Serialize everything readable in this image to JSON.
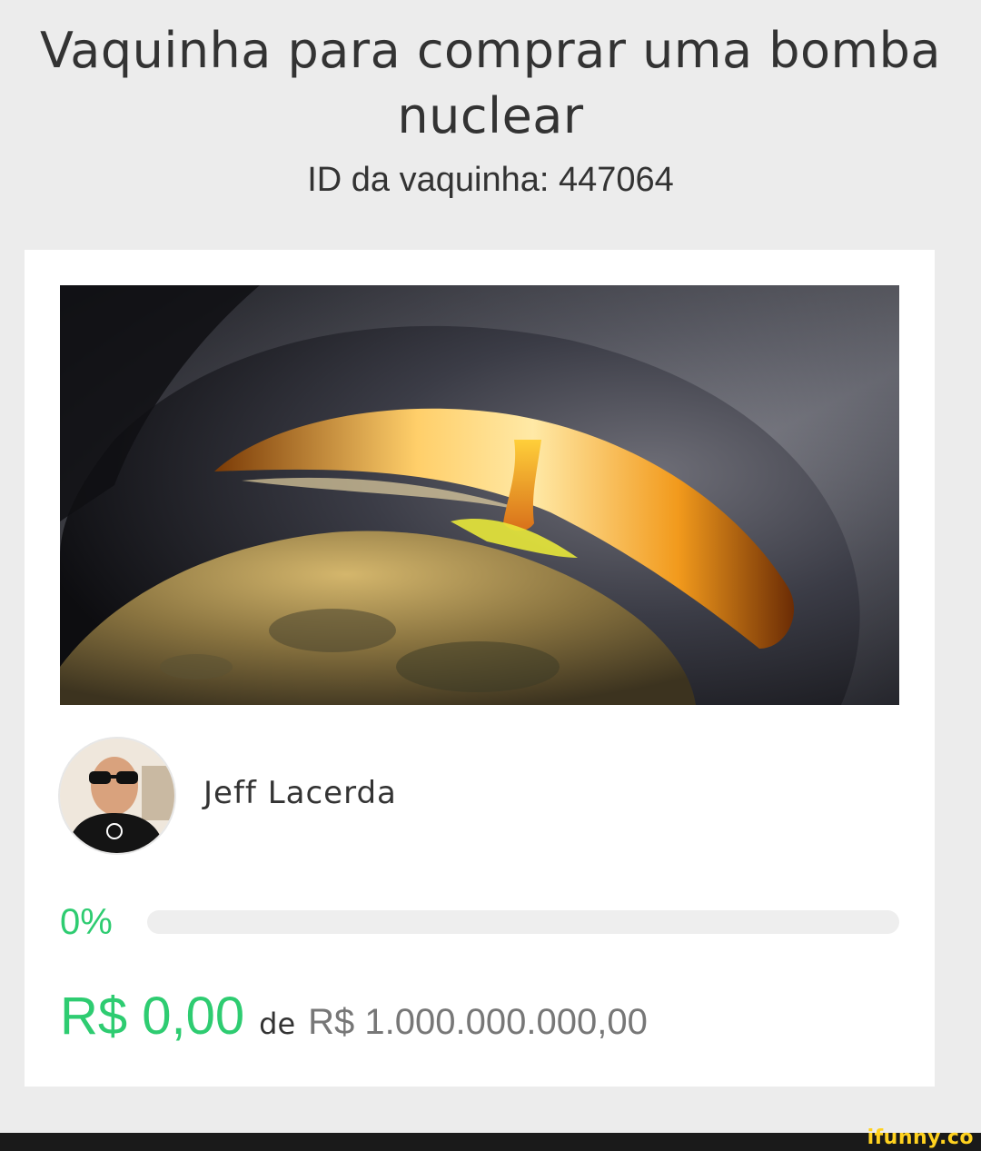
{
  "header": {
    "title": "Vaquinha para comprar uma bomba nuclear",
    "campaign_id_label": "ID da vaquinha: 447064"
  },
  "creator": {
    "name": "Jeff Lacerda"
  },
  "progress": {
    "percent_label": "0%",
    "value": 0
  },
  "amounts": {
    "raised": "R$ 0,00",
    "of_label": "de",
    "goal": "R$ 1.000.000.000,00"
  },
  "watermark": {
    "text": "ifunny.co"
  },
  "colors": {
    "accent": "#2ecc71",
    "text": "#333333",
    "muted": "#777777",
    "background": "#ececec",
    "card": "#ffffff"
  }
}
